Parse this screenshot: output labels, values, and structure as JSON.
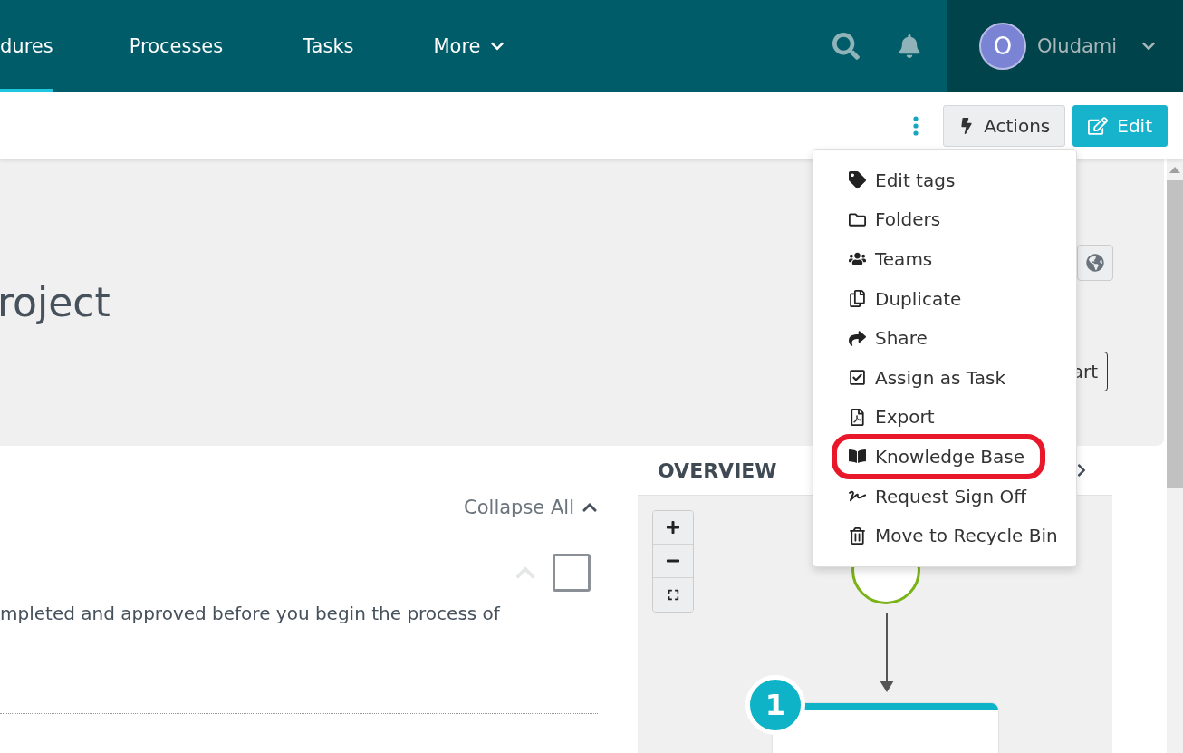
{
  "nav": {
    "tabs": [
      {
        "label": "dures",
        "selected": true,
        "dropdown": false
      },
      {
        "label": "Processes",
        "selected": false,
        "dropdown": false
      },
      {
        "label": "Tasks",
        "selected": false,
        "dropdown": false
      },
      {
        "label": "More",
        "selected": false,
        "dropdown": true
      }
    ],
    "user": {
      "initial": "O",
      "name": "Oludami"
    }
  },
  "toolbar": {
    "buttons": [
      {
        "label": "Actions",
        "kind": "secondary"
      },
      {
        "label": "Edit",
        "kind": "primary"
      }
    ]
  },
  "actions_menu": {
    "items": [
      {
        "label": "Edit tags",
        "highlighted": false
      },
      {
        "label": "Folders",
        "highlighted": false
      },
      {
        "label": "Teams",
        "highlighted": false
      },
      {
        "label": "Duplicate",
        "highlighted": false
      },
      {
        "label": "Share",
        "highlighted": false
      },
      {
        "label": "Assign as Task",
        "highlighted": false
      },
      {
        "label": "Export",
        "highlighted": false
      },
      {
        "label": "Knowledge Base",
        "highlighted": true
      },
      {
        "label": "Request Sign Off",
        "highlighted": false
      },
      {
        "label": "Move to Recycle Bin",
        "highlighted": false
      }
    ]
  },
  "header": {
    "title": "roject",
    "button": "art"
  },
  "content": {
    "collapse_all": "Collapse All",
    "step": {
      "checked": false,
      "text": "mpleted and approved before you begin the process of"
    }
  },
  "overview": {
    "title": "OVERVIEW",
    "step_number": "1"
  }
}
